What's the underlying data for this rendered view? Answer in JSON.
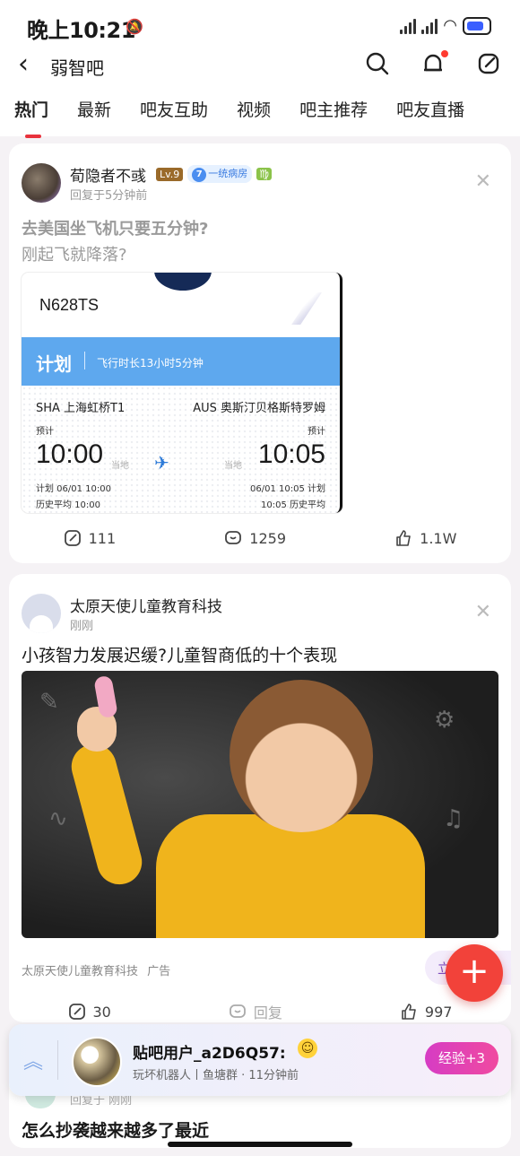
{
  "status": {
    "time": "晚上10:21"
  },
  "navbar": {
    "title": "弱智吧"
  },
  "tabs": [
    "热门",
    "最新",
    "吧友互助",
    "视频",
    "吧主推荐",
    "吧友直播"
  ],
  "post1": {
    "author": "荀隐者不彧",
    "level": "Lv.9",
    "group_num": "7",
    "group": "一统病房",
    "zodiac": "♍",
    "meta": "回复于5分钟前",
    "title_line1": "去美国坐飞机只要五分钟?",
    "title_line2": "刚起飞就降落?",
    "flight": {
      "number": "N628TS",
      "status": "计划",
      "duration": "飞行时长13小时5分钟",
      "from": "SHA 上海虹桥T1",
      "to": "AUS 奥斯汀贝格斯特罗姆",
      "est_left": "预计",
      "est_right": "预计",
      "dep_time": "10:00",
      "arr_time": "10:05",
      "local_left": "当地",
      "local_right": "当地",
      "plan_left": "计划 06/01 10:00",
      "plan_right": "06/01 10:05 计划",
      "hist_left": "历史平均 10:00",
      "hist_right": "10:05 历史平均"
    },
    "shares": "111",
    "comments": "1259",
    "likes": "1.1W"
  },
  "post2": {
    "author": "太原天使儿童教育科技",
    "meta": "刚刚",
    "title": "小孩智力发展迟缓?儿童智商低的十个表现",
    "ad_source": "太原天使儿童教育科技",
    "ad_tag": "广告",
    "cta": "立即",
    "shares": "30",
    "comments": "回复",
    "likes": "997"
  },
  "next": {
    "title": "怎么抄袭越来越多了最近",
    "meta": "回复于 刚刚"
  },
  "toast": {
    "name": "贴吧用户_a2D6Q57:",
    "sub": "玩坏机器人丨鱼塘群 · 11分钟前",
    "button": "经验+3"
  }
}
